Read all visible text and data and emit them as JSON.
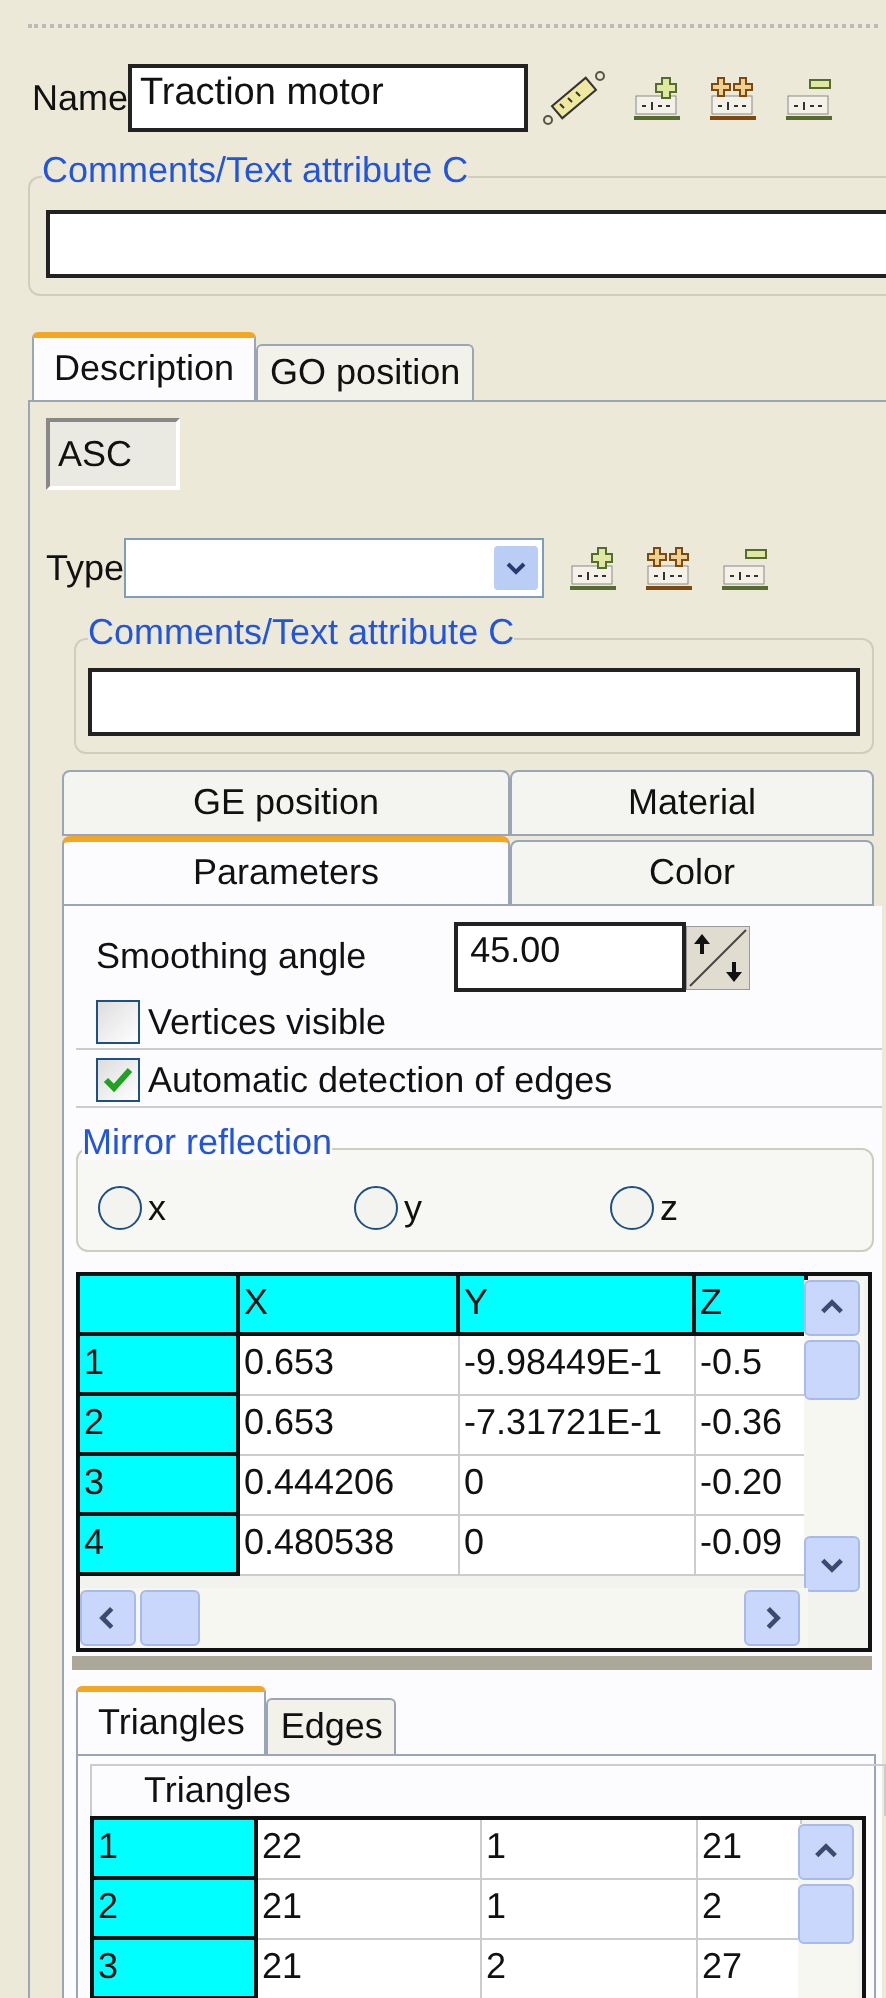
{
  "name_field": {
    "label": "Name",
    "value": "Traction motor"
  },
  "comments": {
    "legend": "Comments/Text attribute C"
  },
  "tabs": [
    {
      "label": "Description",
      "selected": true
    },
    {
      "label": "GO position",
      "selected": false
    }
  ],
  "subtabs": [
    {
      "label": "ASC",
      "selected": true
    }
  ],
  "type_field": {
    "label": "Type"
  },
  "comments_2": {
    "legend": "Comments/Text attribute C"
  },
  "param_tabs": [
    {
      "label": "GE position",
      "selected": false
    },
    {
      "label": "Material",
      "selected": false
    },
    {
      "label": "Parameters",
      "selected": true
    },
    {
      "label": "Color",
      "selected": false
    }
  ],
  "smoothing_angle": {
    "label": "Smoothing angle",
    "value": "45.00"
  },
  "checkboxes": [
    {
      "label": "Vertices visible",
      "checked": false
    },
    {
      "label": "Automatic detection of edges",
      "checked": true
    }
  ],
  "mirror": {
    "legend": "Mirror reflection",
    "options": [
      {
        "label": "x",
        "selected": false
      },
      {
        "label": "y",
        "selected": false
      },
      {
        "label": "z",
        "selected": false
      }
    ]
  },
  "vertex_table": {
    "columns": [
      "X",
      "Y",
      "Z"
    ],
    "rows": [
      {
        "index": "1",
        "cells": [
          "0.653",
          "-9.98449E-1",
          "-0.5"
        ]
      },
      {
        "index": "2",
        "cells": [
          "0.653",
          "-7.31721E-1",
          "-0.36"
        ]
      },
      {
        "index": "3",
        "cells": [
          "0.444206",
          "0",
          "-0.20"
        ]
      },
      {
        "index": "4",
        "cells": [
          "0.480538",
          "0",
          "-0.09"
        ]
      }
    ]
  },
  "bottom_tabs": [
    {
      "label": "Triangles",
      "selected": true
    },
    {
      "label": "Edges",
      "selected": false
    }
  ],
  "triangles": {
    "title": "Triangles",
    "rows": [
      {
        "index": "1",
        "cells": [
          "22",
          "1",
          "21"
        ]
      },
      {
        "index": "2",
        "cells": [
          "21",
          "1",
          "2"
        ]
      },
      {
        "index": "3",
        "cells": [
          "21",
          "2",
          "27"
        ]
      }
    ]
  }
}
